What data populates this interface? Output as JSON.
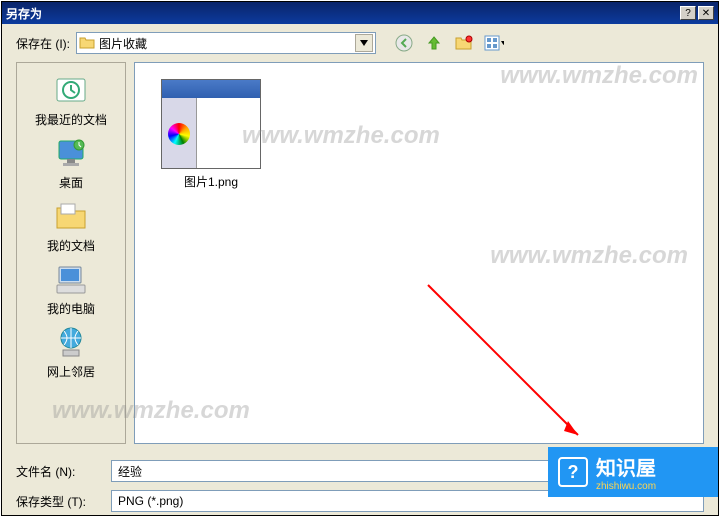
{
  "window": {
    "title": "另存为"
  },
  "toprow": {
    "label": "保存在 (I):",
    "location": "图片收藏"
  },
  "places": {
    "recent": "我最近的文档",
    "desktop": "桌面",
    "mydocs": "我的文档",
    "mycomputer": "我的电脑",
    "network": "网上邻居"
  },
  "file": {
    "thumb_name": "图片1.png"
  },
  "bottom": {
    "filename_label": "文件名 (N):",
    "filename_value": "经验",
    "filetype_label": "保存类型 (T):",
    "filetype_value": "PNG (*.png)"
  },
  "watermark": "www.wmzhe.com",
  "zhishiwu": {
    "main": "知识屋",
    "sub": "zhishiwu.com",
    "icon": "?"
  }
}
